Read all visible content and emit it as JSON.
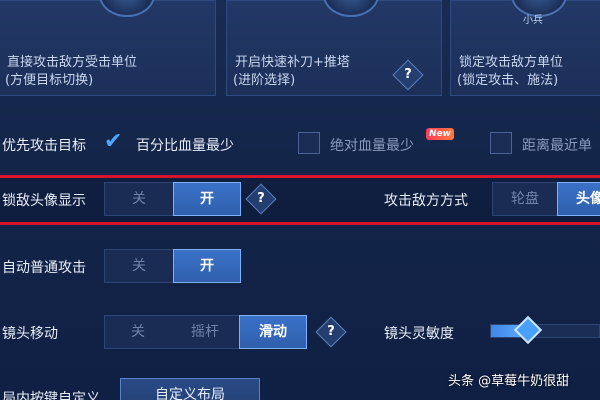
{
  "attack_modes": [
    {
      "line1": "直接攻击敌方受击单位",
      "line2": "(方便目标切换)"
    },
    {
      "line1": "开启快速补刀+推塔",
      "line2": "(进阶选择)",
      "help": "?"
    },
    {
      "line1": "锁定攻击敌方单位",
      "line2": "(锁定攻击、施法)",
      "tag": "小兵"
    }
  ],
  "priority": {
    "label": "优先攻击目标",
    "options": [
      {
        "label": "百分比血量最少",
        "checked": true
      },
      {
        "label": "绝对血量最少",
        "checked": false,
        "badge": "New"
      },
      {
        "label": "距离最近单",
        "checked": false
      }
    ]
  },
  "lock_avatar": {
    "label": "锁敌头像显示",
    "off": "关",
    "on": "开",
    "selected": "on",
    "help": "?"
  },
  "attack_method": {
    "label": "攻击敌方方式",
    "options": [
      "轮盘",
      "头像"
    ],
    "selected": "头像"
  },
  "auto_attack": {
    "label": "自动普通攻击",
    "off": "关",
    "on": "开",
    "selected": "on"
  },
  "camera_move": {
    "label": "镜头移动",
    "options": [
      "关",
      "摇杆",
      "滑动"
    ],
    "selected": "滑动",
    "help": "?"
  },
  "camera_sensitivity": {
    "label": "镜头灵敏度",
    "value": 0.3
  },
  "custom_layout": {
    "label": "局内按键自定义",
    "button": "自定义布局"
  },
  "watermark": "头条 @草莓牛奶很甜",
  "colors": {
    "accent": "#3a72c8",
    "highlight_border": "#d8132b",
    "check": "#4fa6ff"
  }
}
